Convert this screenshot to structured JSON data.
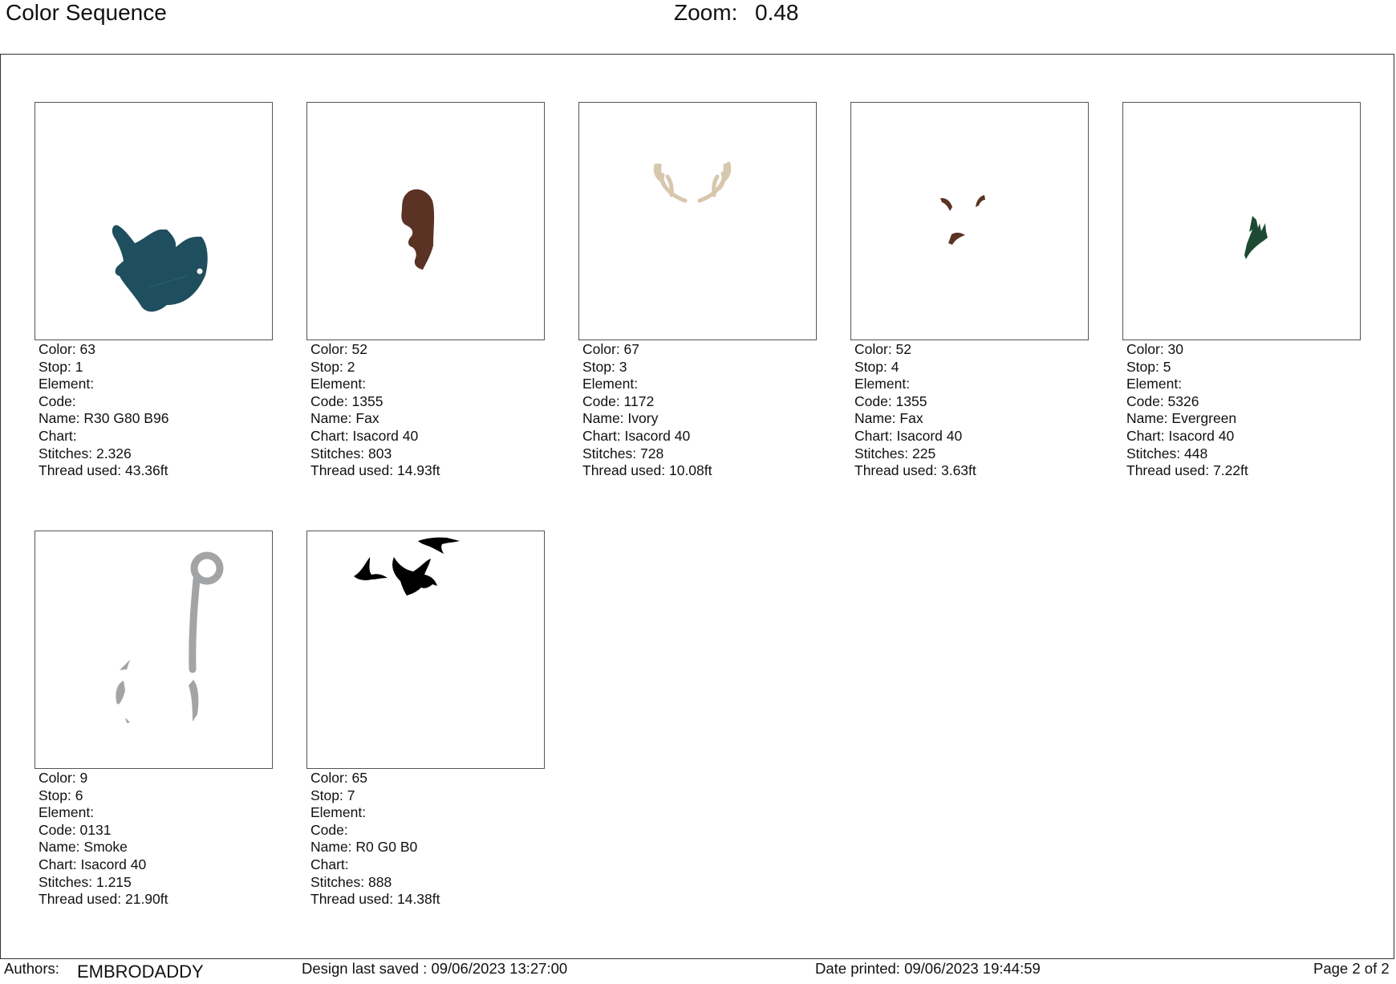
{
  "header": {
    "title": "Color Sequence",
    "zoom_label": "Zoom:",
    "zoom_value": "0.48"
  },
  "colors": {
    "teal": "#1f4e5e",
    "brown": "#5a3324",
    "ivory": "#d6c7ad",
    "evergreen": "#1e4a33",
    "smoke": "#a2a4a6",
    "black": "#000000"
  },
  "items": [
    {
      "color": "Color: 63",
      "stop": "Stop: 1",
      "element": "Element:",
      "code": "Code:",
      "name": "Name: R30 G80 B96",
      "chart": "Chart:",
      "stitches": "Stitches: 2.326",
      "thread": "Thread used: 43.36ft",
      "icon": "fish-icon"
    },
    {
      "color": "Color: 52",
      "stop": "Stop: 2",
      "element": "Element:",
      "code": "Code: 1355",
      "name": "Name: Fax",
      "chart": "Chart: Isacord 40",
      "stitches": "Stitches: 803",
      "thread": "Thread used: 14.93ft",
      "icon": "deer-neck-icon"
    },
    {
      "color": "Color: 67",
      "stop": "Stop: 3",
      "element": "Element:",
      "code": "Code: 1172",
      "name": "Name: Ivory",
      "chart": "Chart: Isacord 40",
      "stitches": "Stitches: 728",
      "thread": "Thread used: 10.08ft",
      "icon": "antlers-icon"
    },
    {
      "color": "Color: 52",
      "stop": "Stop: 4",
      "element": "Element:",
      "code": "Code: 1355",
      "name": "Name: Fax",
      "chart": "Chart: Isacord 40",
      "stitches": "Stitches: 225",
      "thread": "Thread used: 3.63ft",
      "icon": "deer-face-icon"
    },
    {
      "color": "Color: 30",
      "stop": "Stop: 5",
      "element": "Element:",
      "code": "Code: 5326",
      "name": "Name: Evergreen",
      "chart": "Chart: Isacord 40",
      "stitches": "Stitches: 448",
      "thread": "Thread used: 7.22ft",
      "icon": "pine-trees-icon"
    },
    {
      "color": "Color: 9",
      "stop": "Stop: 6",
      "element": "Element:",
      "code": "Code: 0131",
      "name": "Name: Smoke",
      "chart": "Chart: Isacord 40",
      "stitches": "Stitches: 1.215",
      "thread": "Thread used: 21.90ft",
      "icon": "fish-hook-icon"
    },
    {
      "color": "Color: 65",
      "stop": "Stop: 7",
      "element": "Element:",
      "code": "Code:",
      "name": "Name: R0 G0 B0",
      "chart": "Chart:",
      "stitches": "Stitches: 888",
      "thread": "Thread used: 14.38ft",
      "icon": "flying-ducks-icon"
    }
  ],
  "footer": {
    "authors_label": "Authors:",
    "authors_name": "EMBRODADDY",
    "saved": "Design last saved : 09/06/2023 13:27:00",
    "printed": "Date printed: 09/06/2023 19:44:59",
    "page": "Page 2 of 2"
  }
}
